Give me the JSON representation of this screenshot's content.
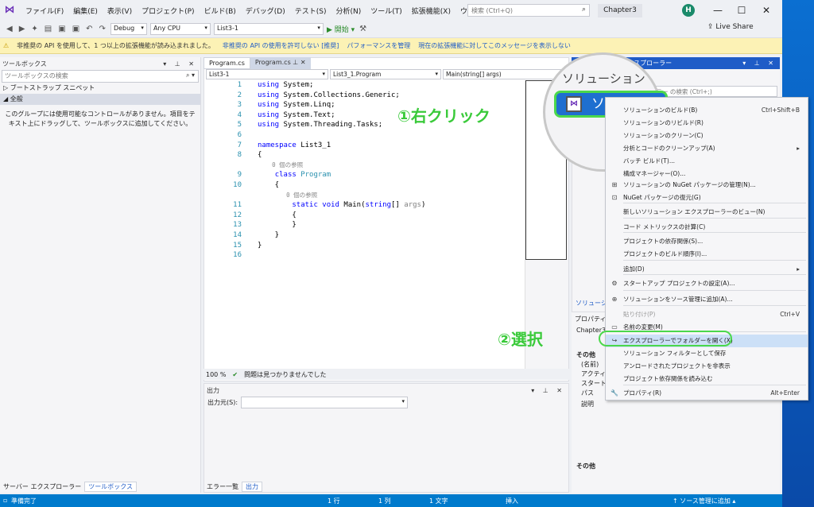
{
  "title": {
    "menu": [
      "ファイル(F)",
      "編集(E)",
      "表示(V)",
      "プロジェクト(P)",
      "ビルド(B)",
      "デバッグ(D)",
      "テスト(S)",
      "分析(N)",
      "ツール(T)",
      "拡張機能(X)",
      "ウィンドウ(W)",
      "ヘルプ(H)"
    ],
    "search_placeholder": "検索 (Ctrl+Q)",
    "solution_name": "Chapter3",
    "avatar_initial": "H",
    "minimize": "—",
    "maximize": "☐",
    "close": "✕"
  },
  "toolbar": {
    "config": "Debug",
    "platform": "Any CPU",
    "project": "List3-1",
    "start": "▶ 開始 ▾",
    "live_share": "Live Share"
  },
  "infobar": {
    "message": "非推奨の API を使用して、1 つ以上の拡張機能が読み込まれました。",
    "links": [
      "非推奨の API の使用を許可しない [推奨]",
      "パフォーマンスを管理",
      "現在の拡張機能に対してこのメッセージを表示しない"
    ]
  },
  "toolbox": {
    "title": "ツールボックス",
    "search": "ツールボックスの検索",
    "sections": [
      "▷ ブートストラップ スニペット",
      "◢ 全般"
    ],
    "message": "このグループには使用可能なコントロールがありません。項目をテキスト上にドラッグして、ツールボックスに追加してください。",
    "tabs": [
      "サーバー エクスプローラー",
      "ツールボックス"
    ]
  },
  "editor": {
    "tabs": [
      "Program.cs",
      "Program.cs"
    ],
    "nav": [
      "List3-1",
      "List3_1.Program",
      "Main(string[] args)"
    ],
    "zoom": "100 %",
    "status": "問題は見つかりませんでした",
    "line_numbers": [
      "1",
      "2",
      "3",
      "4",
      "5",
      "6",
      "7",
      "8",
      "",
      "9",
      "10",
      "",
      "11",
      "12",
      "13",
      "14",
      "15",
      "16"
    ],
    "ref_text": "0 個の参照"
  },
  "output": {
    "title": "出力",
    "source_label": "出力元(S):",
    "tabs": [
      "エラー一覧",
      "出力"
    ]
  },
  "solution_explorer": {
    "title": "ソリューション エクスプローラー",
    "search": "ソリューション エクスプローラー の検索 (Ctrl+;)",
    "props_title": "プロパティ",
    "props_object": "Chapter3",
    "props_cat": "その他",
    "props_rows": [
      "(名前)",
      "アクティブ",
      "スタートア",
      "パス",
      "説明"
    ],
    "props_footer": "その他",
    "sol_tab": "ソリューション"
  },
  "context_menu": [
    {
      "icon": "",
      "label": "ソリューションのビルド(B)",
      "shortcut": "Ctrl+Shift+B"
    },
    {
      "icon": "",
      "label": "ソリューションのリビルド(R)",
      "shortcut": ""
    },
    {
      "icon": "",
      "label": "ソリューションのクリーン(C)",
      "shortcut": ""
    },
    {
      "icon": "",
      "label": "分析とコードのクリーンアップ(A)",
      "shortcut": "▸"
    },
    {
      "icon": "",
      "label": "バッチ ビルド(T)...",
      "shortcut": ""
    },
    {
      "icon": "",
      "label": "構成マネージャー(O)...",
      "shortcut": ""
    },
    {
      "icon": "⊞",
      "label": "ソリューションの NuGet パッケージの管理(N)...",
      "shortcut": ""
    },
    {
      "icon": "⊡",
      "label": "NuGet パッケージの復元(G)",
      "shortcut": ""
    },
    {
      "icon": "",
      "label": "新しいソリューション エクスプローラーのビュー(N)",
      "shortcut": ""
    },
    {
      "icon": "",
      "label": "コード メトリックスの計算(C)",
      "shortcut": ""
    },
    {
      "icon": "",
      "label": "プロジェクトの依存関係(S)...",
      "shortcut": ""
    },
    {
      "icon": "",
      "label": "プロジェクトのビルド順序(I)...",
      "shortcut": ""
    },
    {
      "icon": "",
      "label": "追加(D)",
      "shortcut": "▸"
    },
    {
      "icon": "⚙",
      "label": "スタートアップ プロジェクトの設定(A)...",
      "shortcut": ""
    },
    {
      "icon": "⊕",
      "label": "ソリューションをソース管理に追加(A)...",
      "shortcut": ""
    },
    {
      "icon": "",
      "label": "貼り付け(P)",
      "shortcut": "Ctrl+V"
    },
    {
      "icon": "▭",
      "label": "名前の変更(M)",
      "shortcut": ""
    },
    {
      "icon": "↪",
      "label": "エクスプローラーでフォルダーを開く(X)",
      "shortcut": ""
    },
    {
      "icon": "",
      "label": "ソリューション フィルターとして保存",
      "shortcut": ""
    },
    {
      "icon": "",
      "label": "アンロードされたプロジェクトを非表示",
      "shortcut": ""
    },
    {
      "icon": "",
      "label": "プロジェクト依存関係を読み込む",
      "shortcut": ""
    },
    {
      "icon": "🔧",
      "label": "プロパティ(R)",
      "shortcut": "Alt+Enter"
    }
  ],
  "annotations": {
    "zoom_title": "ソリューション",
    "zoom_selected": "ソリュ",
    "step1": "①右クリック",
    "step2": "②選択"
  },
  "statusbar": {
    "ready": "準備完了",
    "line": "1 行",
    "col": "1 列",
    "char": "1 文字",
    "mode": "挿入",
    "source_control": "↑ ソース管理に追加 ▴"
  }
}
